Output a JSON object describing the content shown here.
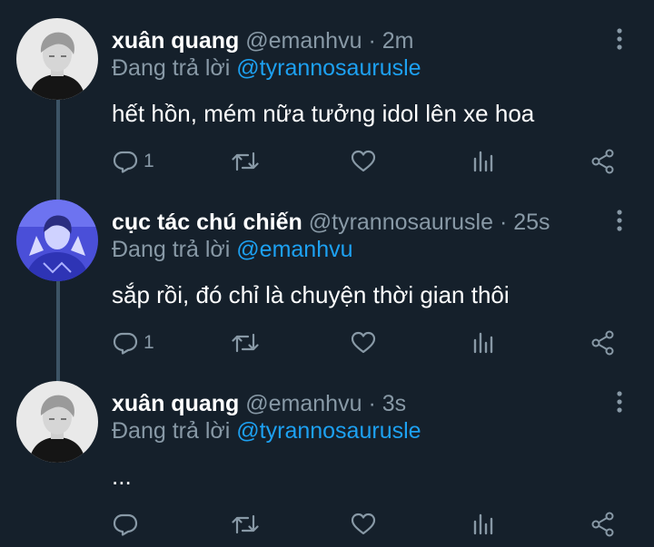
{
  "tweets": [
    {
      "name": "xuân quang",
      "handle": "@emanhvu",
      "separator": "·",
      "time": "2m",
      "replying_prefix": "Đang trả lời",
      "replying_to": "@tyrannosaurusle",
      "text": "hết hồn, mém nữa tưởng idol lên xe hoa",
      "reply_count": "1",
      "avatar": "black-and-white-portrait"
    },
    {
      "name": "cục tác chú chiến",
      "handle": "@tyrannosaurusle",
      "separator": "·",
      "time": "25s",
      "replying_prefix": "Đang trả lời",
      "replying_to": "@emanhvu",
      "text": "sắp rồi, đó chỉ là chuyện thời gian thôi",
      "reply_count": "1",
      "avatar": "blue-tinted-portrait"
    },
    {
      "name": "xuân quang",
      "handle": "@emanhvu",
      "separator": "·",
      "time": "3s",
      "replying_prefix": "Đang trả lời",
      "replying_to": "@tyrannosaurusle",
      "text": "...",
      "reply_count": "",
      "avatar": "black-and-white-portrait"
    }
  ],
  "icons": {
    "reply": "reply-icon",
    "retweet": "retweet-icon",
    "like": "like-icon",
    "stats": "stats-icon",
    "share": "share-icon",
    "more": "more-options-icon"
  },
  "colors": {
    "background": "#15202b",
    "secondary_text": "#8899a6",
    "mention": "#1da1f2",
    "thread_line": "#3d5466"
  }
}
